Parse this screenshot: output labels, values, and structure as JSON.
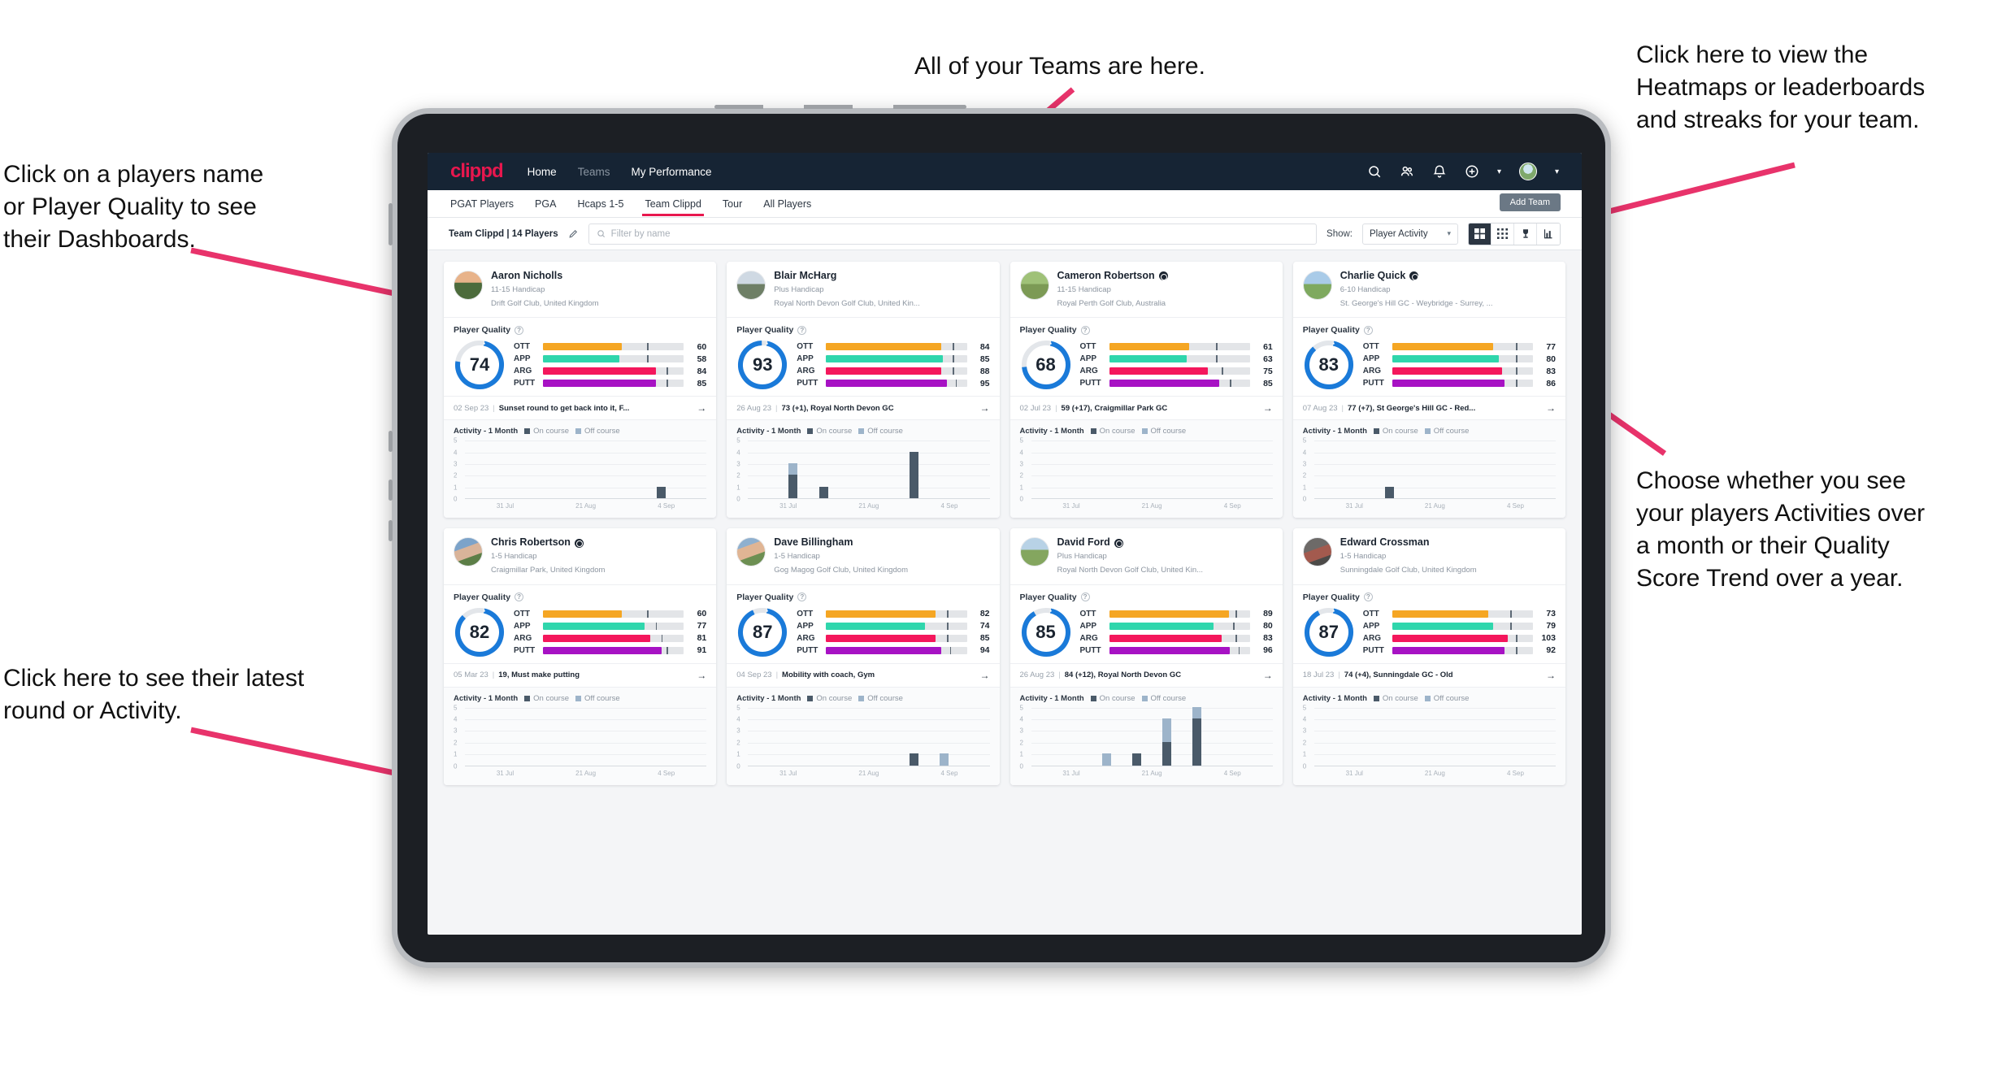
{
  "annotations": [
    {
      "id": "teams",
      "text": "All of your Teams are here."
    },
    {
      "id": "player-name",
      "text": "Click on a players name\nor Player Quality to see\ntheir Dashboards."
    },
    {
      "id": "heatmaps",
      "text": "Click here to view the\nHeatmaps or leaderboards\nand streaks for your team."
    },
    {
      "id": "latest-round",
      "text": "Click here to see their latest\nround or Activity."
    },
    {
      "id": "activity-choice",
      "text": "Choose whether you see\nyour players Activities over\na month or their Quality\nScore Trend over a year."
    }
  ],
  "app": {
    "brand": "clippd",
    "nav": [
      {
        "label": "Home",
        "active": true
      },
      {
        "label": "Teams",
        "active": false
      },
      {
        "label": "My Performance",
        "active": true
      }
    ],
    "top_icons": [
      "search-icon",
      "people-icon",
      "bell-icon",
      "plus-circle-icon",
      "avatar"
    ],
    "subtabs": [
      {
        "label": "PGAT Players",
        "selected": false
      },
      {
        "label": "PGA",
        "selected": false
      },
      {
        "label": "Hcaps 1-5",
        "selected": false
      },
      {
        "label": "Team Clippd",
        "selected": true
      },
      {
        "label": "Tour",
        "selected": false
      },
      {
        "label": "All Players",
        "selected": false
      }
    ],
    "add_team_label": "Add Team",
    "filterbar": {
      "team_label": "Team Clippd | 14 Players",
      "edit_icon": "pencil-icon",
      "search_placeholder": "Filter by name",
      "show_label": "Show:",
      "show_value": "Player Activity",
      "view_buttons": [
        "grid-large-icon",
        "grid-small-icon",
        "trophy-icon",
        "heatmap-icon"
      ],
      "selected_view": 0
    }
  },
  "colors": {
    "brand": "#e8174e",
    "navbar": "#162434",
    "ring": "#1a7ad9",
    "ott": "#f5a623",
    "app": "#2fd6ac",
    "arg": "#f4175c",
    "putt": "#a712c4",
    "on_course": "#4a5a69",
    "off_course": "#9db4ca"
  },
  "legend": {
    "title": "Activity - 1 Month",
    "on": "On course",
    "off": "Off course"
  },
  "player_quality_label": "Player Quality",
  "chart_data": {
    "type": "bar",
    "title": "Activity - 1 Month",
    "ylabel": "",
    "xlabel": "",
    "ylim": [
      0,
      5
    ],
    "yticks": [
      0,
      1,
      2,
      3,
      4,
      5
    ],
    "xticks": [
      "31 Jul",
      "21 Aug",
      "4 Sep"
    ],
    "series_names": [
      "On course",
      "Off course"
    ],
    "slots": 8,
    "per_player": [
      {
        "player": "Aaron Nicholls",
        "on": [
          0,
          0,
          0,
          0,
          0,
          0,
          1,
          0
        ],
        "off": [
          0,
          0,
          0,
          0,
          0,
          0,
          0,
          0
        ]
      },
      {
        "player": "Blair McHarg",
        "on": [
          0,
          2,
          1,
          0,
          0,
          4,
          0,
          0
        ],
        "off": [
          0,
          1,
          0,
          0,
          0,
          0,
          0,
          0
        ]
      },
      {
        "player": "Cameron Robertson",
        "on": [
          0,
          0,
          0,
          0,
          0,
          0,
          0,
          0
        ],
        "off": [
          0,
          0,
          0,
          0,
          0,
          0,
          0,
          0
        ]
      },
      {
        "player": "Charlie Quick",
        "on": [
          0,
          0,
          1,
          0,
          0,
          0,
          0,
          0
        ],
        "off": [
          0,
          0,
          0,
          0,
          0,
          0,
          0,
          0
        ]
      },
      {
        "player": "Chris Robertson",
        "on": [
          0,
          0,
          0,
          0,
          0,
          0,
          0,
          0
        ],
        "off": [
          0,
          0,
          0,
          0,
          0,
          0,
          0,
          0
        ]
      },
      {
        "player": "Dave Billingham",
        "on": [
          0,
          0,
          0,
          0,
          0,
          1,
          0,
          0
        ],
        "off": [
          0,
          0,
          0,
          0,
          0,
          0,
          1,
          0
        ]
      },
      {
        "player": "David Ford",
        "on": [
          0,
          0,
          0,
          1,
          2,
          4,
          0,
          0
        ],
        "off": [
          0,
          0,
          1,
          0,
          2,
          1,
          0,
          0
        ]
      },
      {
        "player": "Edward Crossman",
        "on": [
          0,
          0,
          0,
          0,
          0,
          0,
          0,
          0
        ],
        "off": [
          0,
          0,
          0,
          0,
          0,
          0,
          0,
          0
        ]
      }
    ]
  },
  "players": [
    {
      "name": "Aaron Nicholls",
      "verified": false,
      "avatar": "a1",
      "handicap": "11-15 Handicap",
      "club": "Drift Golf Club, United Kingdom",
      "quality": 74,
      "ring_pct": 74,
      "metrics": [
        {
          "label": "OTT",
          "value": 60,
          "fill": 56,
          "tick": 74
        },
        {
          "label": "APP",
          "value": 58,
          "fill": 54,
          "tick": 74
        },
        {
          "label": "ARG",
          "value": 84,
          "fill": 80,
          "tick": 88
        },
        {
          "label": "PUTT",
          "value": 85,
          "fill": 80,
          "tick": 88
        }
      ],
      "round": {
        "date": "02 Sep 23",
        "text": "Sunset round to get back into it, F..."
      }
    },
    {
      "name": "Blair McHarg",
      "verified": false,
      "avatar": "a2",
      "handicap": "Plus Handicap",
      "club": "Royal North Devon Golf Club, United Kin...",
      "quality": 93,
      "ring_pct": 96,
      "metrics": [
        {
          "label": "OTT",
          "value": 84,
          "fill": 82,
          "tick": 90
        },
        {
          "label": "APP",
          "value": 85,
          "fill": 83,
          "tick": 90
        },
        {
          "label": "ARG",
          "value": 88,
          "fill": 82,
          "tick": 90
        },
        {
          "label": "PUTT",
          "value": 95,
          "fill": 86,
          "tick": 92
        }
      ],
      "round": {
        "date": "26 Aug 23",
        "text": "73 (+1), Royal North Devon GC"
      }
    },
    {
      "name": "Cameron Robertson",
      "verified": true,
      "avatar": "a3",
      "handicap": "11-15 Handicap",
      "club": "Royal Perth Golf Club, Australia",
      "quality": 68,
      "ring_pct": 70,
      "metrics": [
        {
          "label": "OTT",
          "value": 61,
          "fill": 57,
          "tick": 76
        },
        {
          "label": "APP",
          "value": 63,
          "fill": 55,
          "tick": 76
        },
        {
          "label": "ARG",
          "value": 75,
          "fill": 70,
          "tick": 80
        },
        {
          "label": "PUTT",
          "value": 85,
          "fill": 78,
          "tick": 86
        }
      ],
      "round": {
        "date": "02 Jul 23",
        "text": "59 (+17), Craigmillar Park GC"
      }
    },
    {
      "name": "Charlie Quick",
      "verified": true,
      "avatar": "a4",
      "handicap": "6-10 Handicap",
      "club": "St. George's Hill GC - Weybridge - Surrey, ...",
      "quality": 83,
      "ring_pct": 85,
      "metrics": [
        {
          "label": "OTT",
          "value": 77,
          "fill": 72,
          "tick": 88
        },
        {
          "label": "APP",
          "value": 80,
          "fill": 76,
          "tick": 88
        },
        {
          "label": "ARG",
          "value": 83,
          "fill": 78,
          "tick": 88
        },
        {
          "label": "PUTT",
          "value": 86,
          "fill": 80,
          "tick": 88
        }
      ],
      "round": {
        "date": "07 Aug 23",
        "text": "77 (+7), St George's Hill GC - Red..."
      }
    },
    {
      "name": "Chris Robertson",
      "verified": true,
      "avatar": "a5",
      "handicap": "1-5 Handicap",
      "club": "Craigmillar Park, United Kingdom",
      "quality": 82,
      "ring_pct": 84,
      "metrics": [
        {
          "label": "OTT",
          "value": 60,
          "fill": 56,
          "tick": 74
        },
        {
          "label": "APP",
          "value": 77,
          "fill": 72,
          "tick": 80
        },
        {
          "label": "ARG",
          "value": 81,
          "fill": 76,
          "tick": 84
        },
        {
          "label": "PUTT",
          "value": 91,
          "fill": 84,
          "tick": 88
        }
      ],
      "round": {
        "date": "05 Mar 23",
        "text": "19, Must make putting"
      }
    },
    {
      "name": "Dave Billingham",
      "verified": false,
      "avatar": "a6",
      "handicap": "1-5 Handicap",
      "club": "Gog Magog Golf Club, United Kingdom",
      "quality": 87,
      "ring_pct": 90,
      "metrics": [
        {
          "label": "OTT",
          "value": 82,
          "fill": 78,
          "tick": 86
        },
        {
          "label": "APP",
          "value": 74,
          "fill": 70,
          "tick": 86
        },
        {
          "label": "ARG",
          "value": 85,
          "fill": 78,
          "tick": 86
        },
        {
          "label": "PUTT",
          "value": 94,
          "fill": 82,
          "tick": 88
        }
      ],
      "round": {
        "date": "04 Sep 23",
        "text": "Mobility with coach, Gym"
      }
    },
    {
      "name": "David Ford",
      "verified": true,
      "avatar": "a7",
      "handicap": "Plus Handicap",
      "club": "Royal North Devon Golf Club, United Kin...",
      "quality": 85,
      "ring_pct": 88,
      "metrics": [
        {
          "label": "OTT",
          "value": 89,
          "fill": 85,
          "tick": 90
        },
        {
          "label": "APP",
          "value": 80,
          "fill": 74,
          "tick": 88
        },
        {
          "label": "ARG",
          "value": 83,
          "fill": 80,
          "tick": 90
        },
        {
          "label": "PUTT",
          "value": 96,
          "fill": 86,
          "tick": 92
        }
      ],
      "round": {
        "date": "26 Aug 23",
        "text": "84 (+12), Royal North Devon GC"
      }
    },
    {
      "name": "Edward Crossman",
      "verified": false,
      "avatar": "a8",
      "handicap": "1-5 Handicap",
      "club": "Sunningdale Golf Club, United Kingdom",
      "quality": 87,
      "ring_pct": 89,
      "metrics": [
        {
          "label": "OTT",
          "value": 73,
          "fill": 68,
          "tick": 84
        },
        {
          "label": "APP",
          "value": 79,
          "fill": 72,
          "tick": 84
        },
        {
          "label": "ARG",
          "value": 103,
          "fill": 82,
          "tick": 88
        },
        {
          "label": "PUTT",
          "value": 92,
          "fill": 80,
          "tick": 88
        }
      ],
      "round": {
        "date": "18 Jul 23",
        "text": "74 (+4), Sunningdale GC - Old"
      }
    }
  ]
}
